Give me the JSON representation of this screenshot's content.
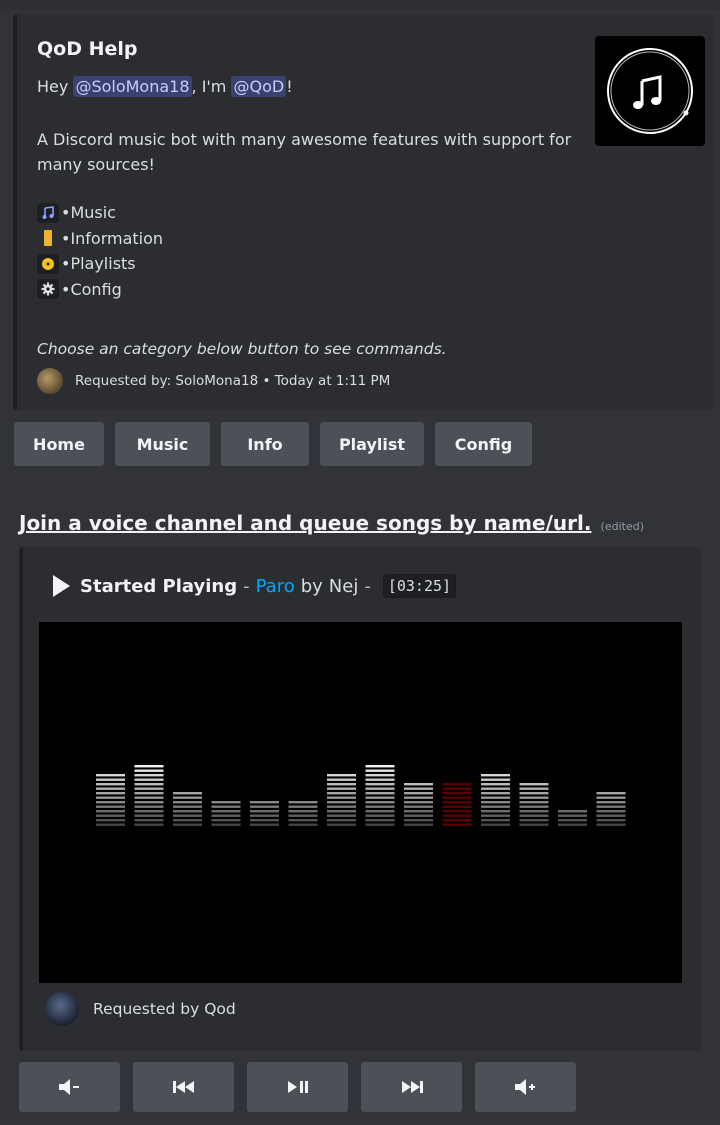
{
  "help_embed": {
    "title": "QoD Help",
    "greeting_prefix": "Hey",
    "user_mention": "@SoloMona18",
    "greeting_middle": ", I'm",
    "bot_mention": "@QoD",
    "greeting_suffix": "!",
    "description": "A Discord music bot with many awesome features with support for many sources!",
    "categories": [
      {
        "icon": "music-note-icon",
        "label": "•Music"
      },
      {
        "icon": "information-icon",
        "label": "•Information"
      },
      {
        "icon": "playlist-disc-icon",
        "label": "•Playlists"
      },
      {
        "icon": "gear-icon",
        "label": "•Config"
      }
    ],
    "instruction": "Choose an category below button to see commands.",
    "footer": "Requested by: SoloMona18 • Today at 1:11 PM"
  },
  "category_buttons": [
    {
      "label": "Home"
    },
    {
      "label": "Music"
    },
    {
      "label": "Info"
    },
    {
      "label": "Playlist"
    },
    {
      "label": "Config"
    }
  ],
  "message": {
    "text": "Join a voice channel and queue songs by name/url.",
    "edited": "(edited)"
  },
  "player_embed": {
    "status": "Started Playing",
    "separator1": "-",
    "song": "Paro",
    "by": "by",
    "artist": "Nej",
    "separator2": "-",
    "duration": "[03:25]",
    "footer": "Requested by Qod",
    "equalizer": {
      "levels": [
        6,
        7,
        4,
        3,
        3,
        3,
        6,
        7,
        5,
        5,
        6,
        5,
        2,
        4
      ],
      "highlight_index": 9,
      "highlight_color": "#5a0000"
    }
  },
  "control_buttons": [
    {
      "icon": "volume-down-icon",
      "glyph": "◀-"
    },
    {
      "icon": "previous-track-icon",
      "glyph": "⏮"
    },
    {
      "icon": "play-pause-icon",
      "glyph": "⏯"
    },
    {
      "icon": "next-track-icon",
      "glyph": "⏭"
    },
    {
      "icon": "volume-up-icon",
      "glyph": "◀+"
    }
  ],
  "colors": {
    "background": "#313338",
    "embed": "#2b2d31",
    "button": "#4e5058",
    "mention_bg": "#3c4270",
    "link": "#00a8fc"
  }
}
